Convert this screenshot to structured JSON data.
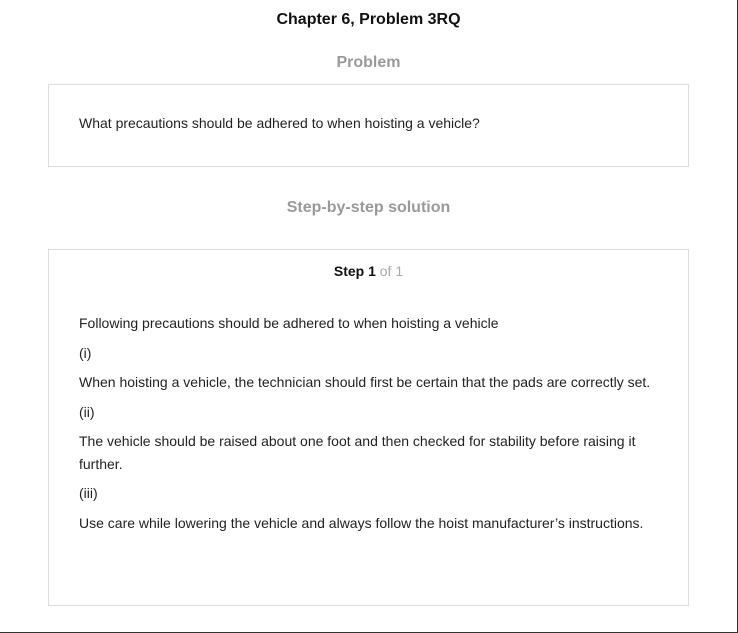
{
  "header": {
    "title": "Chapter 6, Problem 3RQ"
  },
  "problem": {
    "heading": "Problem",
    "text": "What precautions should be adhered to when hoisting a vehicle?"
  },
  "solution": {
    "heading": "Step-by-step solution",
    "step": {
      "label": "Step 1",
      "of_text": " of 1",
      "paragraphs": [
        "Following precautions should be adhered to when hoisting a vehicle",
        "(i)",
        "When hoisting a vehicle, the technician should first be certain that the pads are correctly set.",
        "(ii)",
        "The vehicle should be raised about one foot and then checked for stability before raising it further.",
        "(iii)",
        "Use care while lowering the vehicle and always follow the hoist manufacturer’s instructions."
      ]
    }
  },
  "colors": {
    "section_heading": "#999999",
    "border": "#dcdcdc",
    "text": "#222222"
  }
}
